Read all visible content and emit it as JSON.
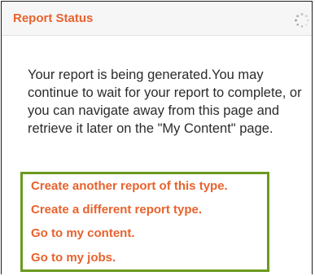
{
  "header": {
    "title": "Report Status",
    "spinner_icon": "loading-spinner-icon"
  },
  "message": {
    "text": "Your report is being generated.You may continue to wait for your report to complete, or you can navigate away from this page and retrieve it later on the \"My Content\" page."
  },
  "links": [
    {
      "label": "Create another report of this type."
    },
    {
      "label": "Create a different report type."
    },
    {
      "label": "Go to my content."
    },
    {
      "label": "Go to my jobs."
    }
  ],
  "colors": {
    "accent": "#e8622d",
    "highlight_border": "#6b9a1f",
    "header_bg": "#f6f6f6",
    "text": "#2b2b2b"
  }
}
